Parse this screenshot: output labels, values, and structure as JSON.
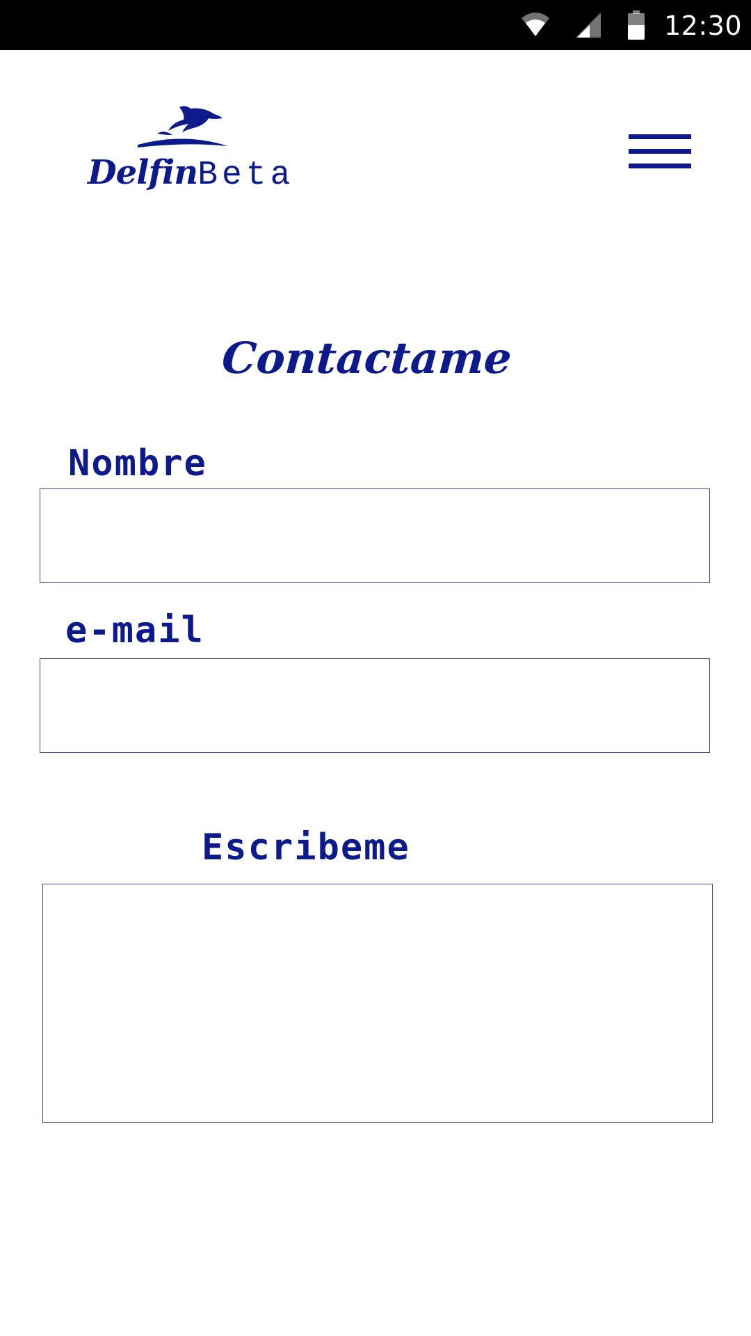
{
  "status_bar": {
    "time": "12:30",
    "icons": [
      "wifi-icon",
      "cell-signal-icon",
      "battery-icon"
    ]
  },
  "header": {
    "logo": {
      "word1": "Delfin",
      "word2": "Beta",
      "icon": "dolphin-icon"
    },
    "menu_icon": "hamburger-menu-icon"
  },
  "form": {
    "title": "Contactame",
    "name_label": "Nombre",
    "name_value": "",
    "email_label": "e-mail",
    "email_value": "",
    "message_label": "Escribeme",
    "message_value": ""
  },
  "colors": {
    "accent": "#0c1a8c",
    "border": "#3a4a9e",
    "status_bar": "#000000",
    "background": "#ffffff"
  }
}
